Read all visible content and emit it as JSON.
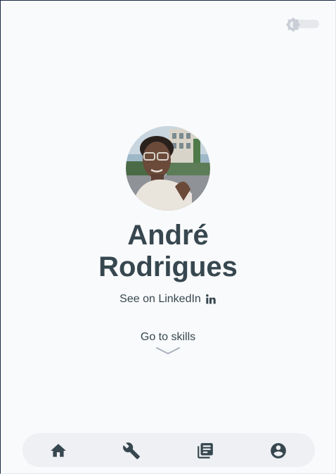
{
  "profile": {
    "name_line1": "André",
    "name_line2": "Rodrigues",
    "linkedin_label": "See on LinkedIn",
    "skills_label": "Go to skills"
  },
  "theme_toggle": {
    "icon": "brightness-icon",
    "state": "light"
  },
  "bottom_nav": {
    "items": [
      {
        "id": "home",
        "icon": "home-icon"
      },
      {
        "id": "skills",
        "icon": "wrench-icon"
      },
      {
        "id": "articles",
        "icon": "library-books-icon"
      },
      {
        "id": "profile",
        "icon": "account-circle-icon"
      }
    ]
  },
  "colors": {
    "background": "#f9fafb",
    "text": "#37474f",
    "nav_background": "#eef0f3",
    "toggle_track": "#e6e8ec",
    "toggle_thumb": "#c9ced6"
  }
}
